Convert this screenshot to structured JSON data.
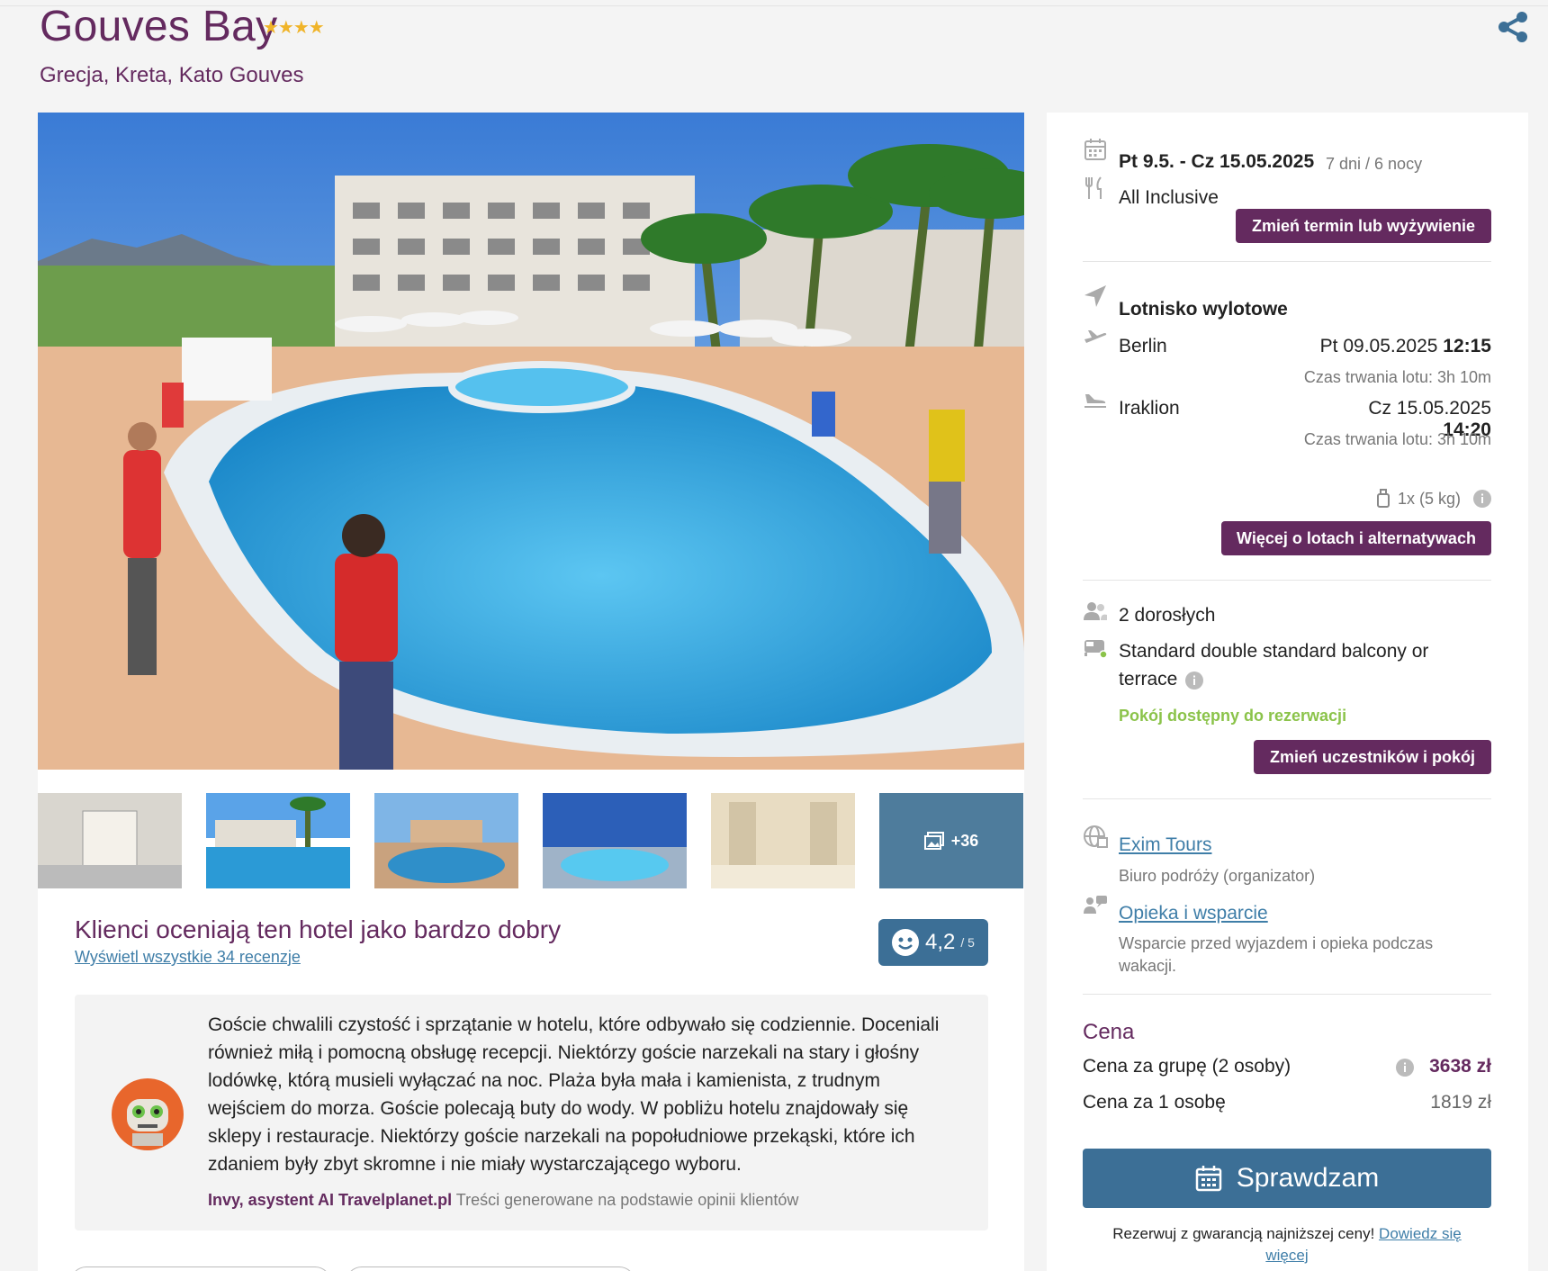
{
  "hotel": {
    "name": "Gouves Bay",
    "stars": "★★★★",
    "location": "Grecja, Kreta, Kato Gouves"
  },
  "gallery": {
    "more_count": "+36",
    "thumbnails": [
      "lobby",
      "pool-side",
      "pool-sunset",
      "pool-night",
      "hall",
      "more"
    ]
  },
  "rating": {
    "headline": "Klienci oceniają ten hotel jako bardzo dobry",
    "reviews_link": "Wyświetl wszystkie 34 recenzje",
    "score": "4,2",
    "score_max": "/ 5"
  },
  "ai_summary": {
    "text": "Goście chwalili czystość i sprzątanie w hotelu, które odbywało się codziennie. Doceniali również miłą i pomocną obsługę recepcji. Niektórzy goście narzekali na stary i głośny lodówkę, którą musieli wyłączać na noc. Plaża była mała i kamienista, z trudnym wejściem do morza. Goście polecają buty do wody. W pobliżu hotelu znajdowały się sklepy i restauracje. Niektórzy goście narzekali na popołudniowe przekąski, które ich zdaniem były zbyt skromne i nie miały wystarczającego wyboru.",
    "author": "Invy, asystent AI Travelplanet.pl",
    "note": "Treści generowane na podstawie opinii klientów"
  },
  "booking": {
    "dates": "Pt 9.5. - Cz 15.05.2025",
    "duration": "7 dni / 6 nocy",
    "board": "All Inclusive",
    "change_date_button": "Zmień termin lub wyżywienie",
    "airport_label": "Lotnisko wylotowe",
    "outbound": {
      "city": "Berlin",
      "date": "Pt 09.05.2025",
      "time": "12:15",
      "duration": "Czas trwania lotu: 3h 10m"
    },
    "inbound": {
      "city": "Iraklion",
      "date": "Cz 15.05.2025",
      "time": "14:20",
      "duration": "Czas trwania lotu: 3h 10m"
    },
    "baggage": "1x (5 kg)",
    "flights_button": "Więcej o lotach i alternatywach",
    "travellers": "2 dorosłych",
    "room_line1": "Standard double standard balcony or",
    "room_line2": "terrace",
    "room_status": "Pokój dostępny do rezerwacji",
    "room_status_color": "#8bc34a",
    "change_room_button": "Zmień uczestników i pokój",
    "operator": "Exim Tours",
    "operator_desc": "Biuro podróży (organizator)",
    "support": "Opieka i wsparcie",
    "support_desc_1": "Wsparcie przed wyjazdem i opieka podczas",
    "support_desc_2": "wakacji.",
    "price_header": "Cena",
    "group_label": "Cena za grupę (2 osoby)",
    "group_price": "3638 zł",
    "per_person_label": "Cena za 1 osobę",
    "per_person_price": "1819 zł",
    "cta": "Sprawdzam",
    "guarantee": "Rezerwuj z gwarancją najniższej ceny!",
    "guarantee_link_1": "Dowiedz się",
    "guarantee_link_2": "więcej"
  },
  "colors": {
    "brand_purple": "#642a5f",
    "brand_blue": "#3c6f96",
    "link": "#3f7ea8"
  }
}
